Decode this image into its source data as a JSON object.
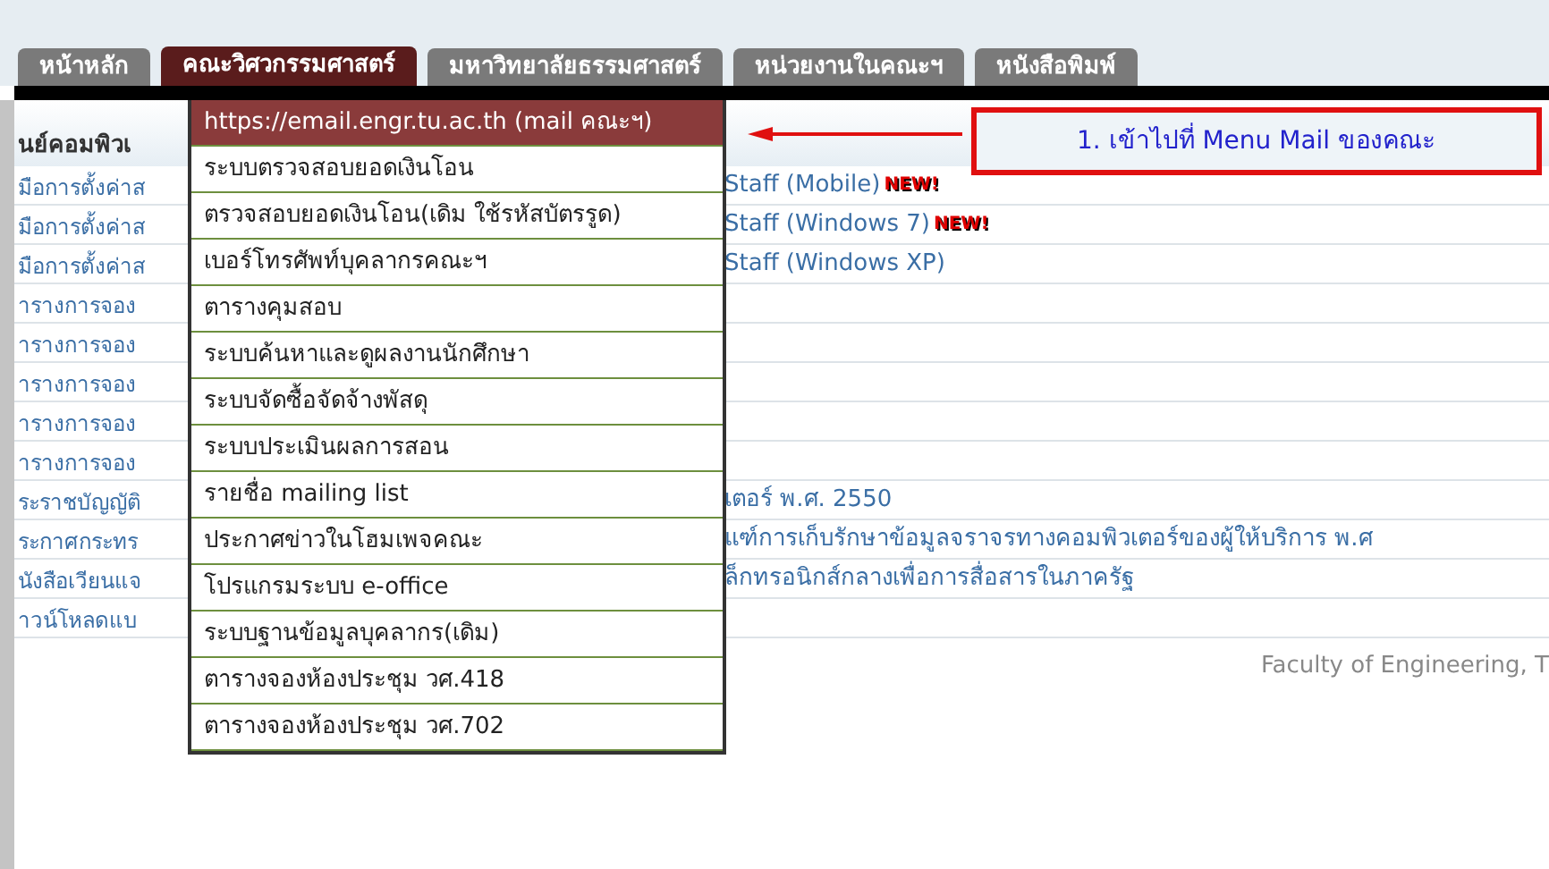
{
  "tabs": [
    {
      "label": "หน้าหลัก",
      "selected": false
    },
    {
      "label": "คณะวิศวกรรมศาสตร์",
      "selected": true
    },
    {
      "label": "มหาวิทยาลัยธรรมศาสตร์",
      "selected": false
    },
    {
      "label": "หน่วยงานในคณะฯ",
      "selected": false
    },
    {
      "label": "หนังสือพิมพ์",
      "selected": false
    }
  ],
  "content": {
    "heading": "นย์คอมพิวเ",
    "rows": [
      {
        "left": "มือการตั้งค่าส",
        "right": "Staff (Mobile)",
        "badge": "NEW!"
      },
      {
        "left": "มือการตั้งค่าส",
        "right": "Staff (Windows 7)",
        "badge": "NEW!"
      },
      {
        "left": "มือการตั้งค่าส",
        "right": "Staff (Windows XP)"
      },
      {
        "left": "ารางการจอง"
      },
      {
        "left": "ารางการจอง"
      },
      {
        "left": "ารางการจอง"
      },
      {
        "left": "ารางการจอง"
      },
      {
        "left": "ารางการจอง"
      },
      {
        "left": "ระราชบัญญัติ",
        "right": "เตอร์ พ.ศ. 2550"
      },
      {
        "left": "ระกาศกระทร",
        "right": "แฑ์การเก็บรักษาข้อมูลจราจรทางคอมพิวเตอร์ของผู้ให้บริการ พ.ศ"
      },
      {
        "left": "นังสือเวียนแจ",
        "right": "ล็กทรอนิกส์กลางเพื่อการสื่อสารในภาครัฐ"
      },
      {
        "left": "าวน์โหลดแบ"
      }
    ],
    "footer": "Faculty of Engineering, T"
  },
  "dropdown": {
    "items": [
      {
        "label": "https://email.engr.tu.ac.th (mail คณะฯ)",
        "selected": true
      },
      {
        "label": "ระบบตรวจสอบยอดเงินโอน",
        "selected": false
      },
      {
        "label": "ตรวจสอบยอดเงินโอน(เดิม ใช้รหัสบัตรรูด)",
        "selected": false
      },
      {
        "label": "เบอร์โทรศัพท์บุคลากรคณะฯ",
        "selected": false
      },
      {
        "label": "ตารางคุมสอบ",
        "selected": false
      },
      {
        "label": "ระบบค้นหาและดูผลงานนักศึกษา",
        "selected": false
      },
      {
        "label": "ระบบจัดซื้อจัดจ้างพัสดุ",
        "selected": false
      },
      {
        "label": "ระบบประเมินผลการสอน",
        "selected": false
      },
      {
        "label": "รายชื่อ mailing list",
        "selected": false
      },
      {
        "label": "ประกาศข่าวในโฮมเพจคณะ",
        "selected": false
      },
      {
        "label": "โปรแกรมระบบ e-office",
        "selected": false
      },
      {
        "label": "ระบบฐานข้อมูลบุคลากร(เดิม)",
        "selected": false
      },
      {
        "label": "ตารางจองห้องประชุม วศ.418",
        "selected": false
      },
      {
        "label": "ตารางจองห้องประชุม วศ.702",
        "selected": false
      }
    ]
  },
  "annotation": {
    "text": "1. เข้าไปที่ Menu Mail ของคณะ"
  }
}
